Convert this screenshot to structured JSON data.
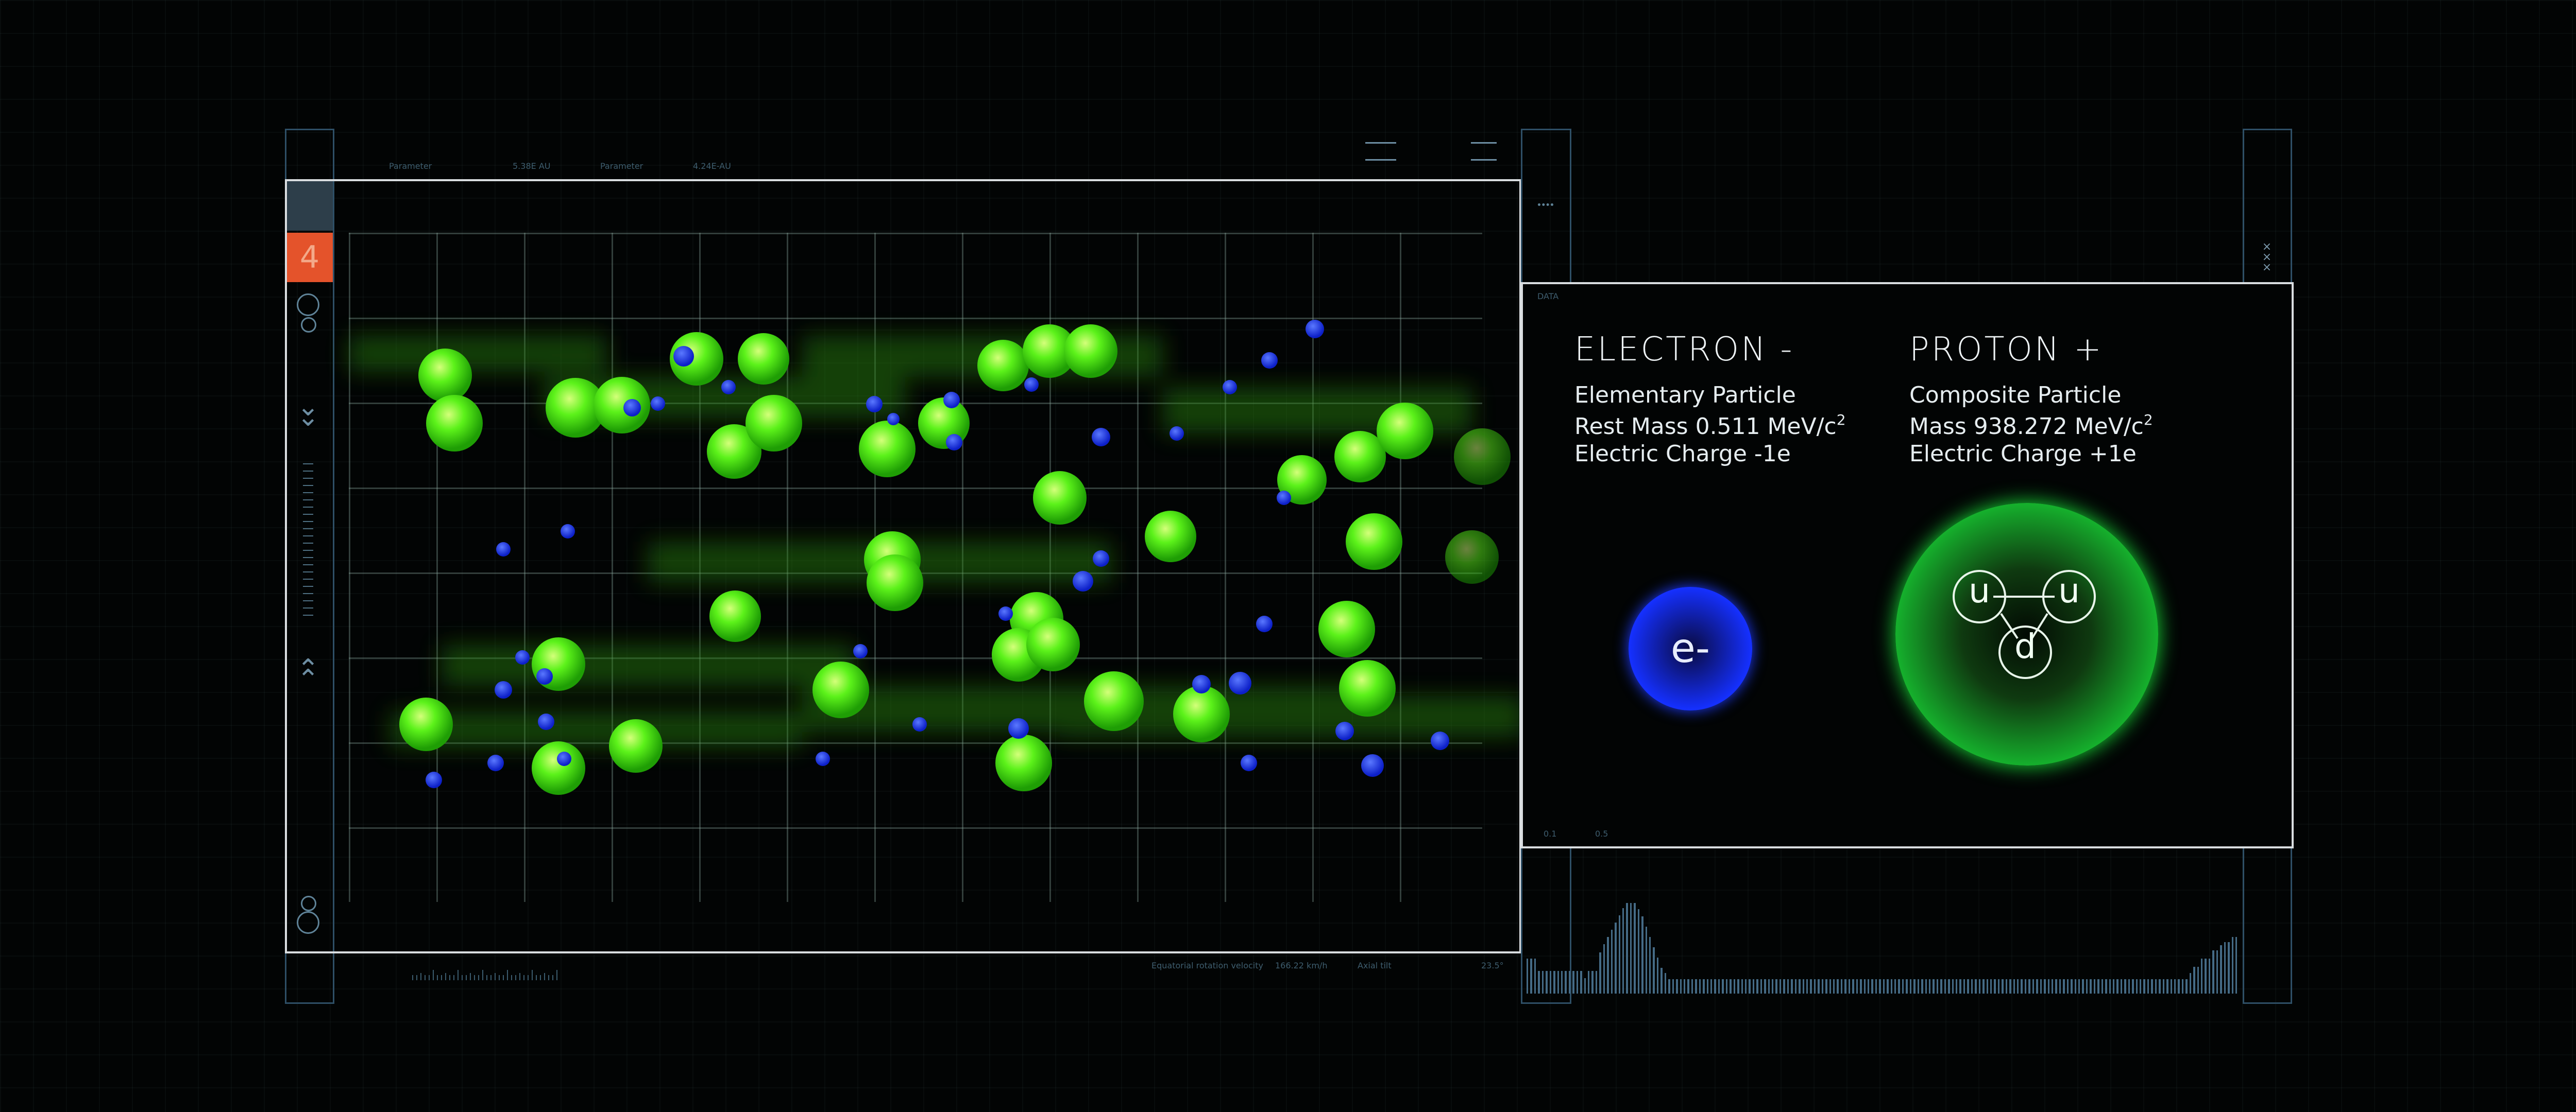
{
  "viewer": {
    "index_label": "4",
    "header_readouts": [
      "Parameter",
      "5.38E AU",
      "Parameter",
      "4.24E-AU"
    ],
    "footer_readouts": [
      "Equatorial rotation velocity",
      "166.22 km/h",
      "Axial tilt",
      "23.5°"
    ]
  },
  "particles": {
    "section_label": "DATA",
    "electron": {
      "title": "ELECTRON -",
      "line1": "Elementary Particle",
      "line2": "Rest Mass 0.511 MeV/c",
      "line3": "Electric Charge -1e",
      "symbol": "e-",
      "color": "#1f3bff"
    },
    "proton": {
      "title": "PROTON +",
      "line1": "Composite Particle",
      "line2": "Mass 938.272 MeV/c",
      "line3": "Electric Charge +1e",
      "quarks": [
        "u",
        "u",
        "d"
      ],
      "color": "#18e038"
    },
    "scale_labels": [
      "0.1",
      "0.5"
    ],
    "superscript": "2"
  },
  "colors": {
    "electron_blue": "#1f3bff",
    "proton_green": "#4cff1a",
    "accent_orange": "#e4532b",
    "frame": "#d9dde0",
    "rail": "#2e4f66"
  },
  "icons": [
    "chevron-down-icon",
    "chevron-up-icon",
    "target-icon",
    "close-icon",
    "menu-icon"
  ]
}
